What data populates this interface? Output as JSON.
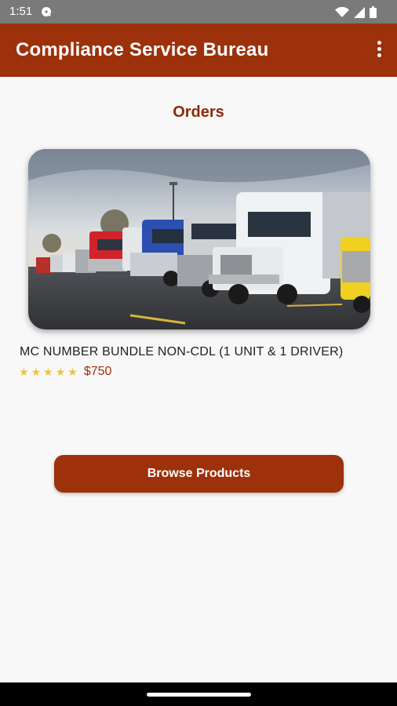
{
  "status_bar": {
    "time": "1:51",
    "icons": [
      "chat-notification-icon",
      "wifi-icon",
      "signal-icon",
      "battery-icon"
    ]
  },
  "app_bar": {
    "title": "Compliance Service Bureau",
    "menu_icon": "more-vert-icon",
    "background": "#9c310b"
  },
  "page": {
    "title": "Orders"
  },
  "orders": [
    {
      "name": "MC NUMBER BUNDLE NON-CDL (1 UNIT & 1 DRIVER)",
      "rating": 5,
      "rating_max": 5,
      "price": "$750",
      "image": "row-of-semi-trucks-photo"
    }
  ],
  "actions": {
    "browse_label": "Browse Products"
  },
  "colors": {
    "brand": "#9c310b",
    "star": "#f1c232",
    "title_text": "#8e2a0d"
  }
}
